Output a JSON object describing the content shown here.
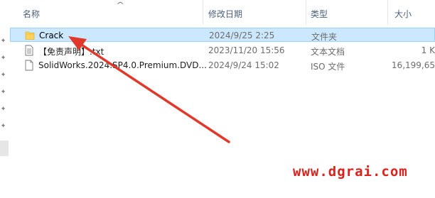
{
  "columns": {
    "name": "名称",
    "modified": "修改日期",
    "type": "类型",
    "size": "大小"
  },
  "files": [
    {
      "name": "Crack",
      "modified": "2024/9/25 2:25",
      "type": "文件夹",
      "size": "",
      "icon": "folder-icon",
      "selected": true
    },
    {
      "name": "【免责声明】.txt",
      "modified": "2023/11/20 15:56",
      "type": "文本文档",
      "size": "1 K",
      "icon": "text-file-icon",
      "selected": false
    },
    {
      "name": "SolidWorks.2024.SP4.0.Premium.DVD...",
      "modified": "2024/9/24 15:02",
      "type": "ISO 文件",
      "size": "16,199,65",
      "icon": "iso-file-icon",
      "selected": false
    }
  ],
  "watermark": "www.dgrai.com",
  "colors": {
    "selection_bg": "#cce8ff",
    "selection_border": "#99d1ff",
    "folder": "#ffd35b",
    "arrow": "#e0382a",
    "watermark": "#d9221b"
  }
}
